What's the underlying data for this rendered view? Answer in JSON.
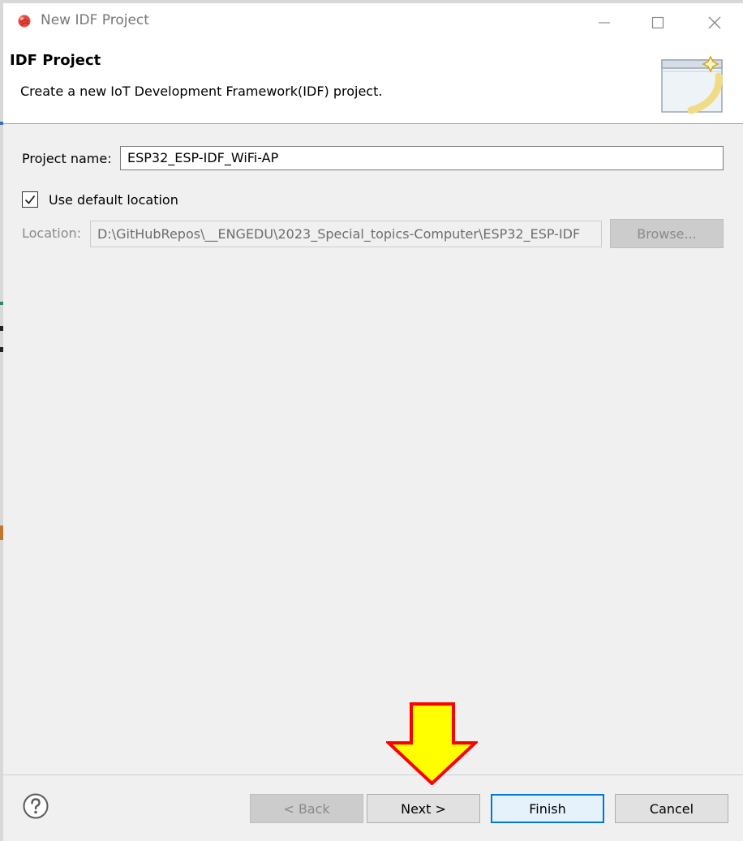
{
  "window": {
    "title": "New IDF Project"
  },
  "header": {
    "title": "IDF Project",
    "description": "Create a new IoT Development Framework(IDF) project."
  },
  "form": {
    "project_name_label": "Project name:",
    "project_name_value": "ESP32_ESP-IDF_WiFi-AP",
    "use_default_location_label": "Use default location",
    "use_default_location_checked": true,
    "location_label": "Location:",
    "location_value": "D:\\GitHubRepos\\__ENGEDU\\2023_Special_topics-Computer\\ESP32_ESP-IDF",
    "browse_label": "Browse..."
  },
  "footer": {
    "back_label": "< Back",
    "next_label": "Next >",
    "finish_label": "Finish",
    "cancel_label": "Cancel"
  },
  "icons": {
    "app": "espressif-logo-icon",
    "minimize": "minimize-icon",
    "maximize": "maximize-icon",
    "close": "close-icon",
    "banner": "new-project-wizard-icon",
    "help": "help-icon",
    "annotation": "down-arrow-annotation"
  },
  "colors": {
    "accent": "#0078d7",
    "arrow_fill": "#ffff00",
    "arrow_stroke": "#ff0000",
    "app_icon": "#e8493f"
  }
}
